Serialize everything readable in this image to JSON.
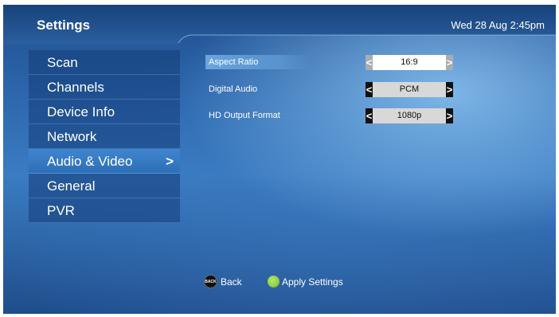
{
  "header": {
    "title": "Settings",
    "datetime": "Wed 28 Aug 2:45pm"
  },
  "sidebar": {
    "items": [
      {
        "label": "Scan",
        "selected": false
      },
      {
        "label": "Channels",
        "selected": false
      },
      {
        "label": "Device Info",
        "selected": false
      },
      {
        "label": "Network",
        "selected": false
      },
      {
        "label": "Audio & Video",
        "selected": true
      },
      {
        "label": "General",
        "selected": false
      },
      {
        "label": "PVR",
        "selected": false
      }
    ],
    "selected_arrow": ">"
  },
  "settings": [
    {
      "label": "Aspect Ratio",
      "value": "16:9",
      "focused": true
    },
    {
      "label": "Digital Audio",
      "value": "PCM",
      "focused": false
    },
    {
      "label": "HD Output Format",
      "value": "1080p",
      "focused": false
    }
  ],
  "selector_arrows": {
    "left": "<",
    "right": ">"
  },
  "footer": {
    "back_badge": "BACK",
    "back_label": "Back",
    "apply_label": "Apply Settings"
  },
  "colors": {
    "background": "#2d67ad",
    "header_band": "#1c4b86",
    "selected_item": "#3a7cc2",
    "apply_button": "#7bbd2a"
  },
  "icons": {
    "back": "back-button-icon",
    "apply": "green-button-icon",
    "selector_left": "chevron-left-icon",
    "selector_right": "chevron-right-icon",
    "selected_item": "chevron-right-icon"
  }
}
